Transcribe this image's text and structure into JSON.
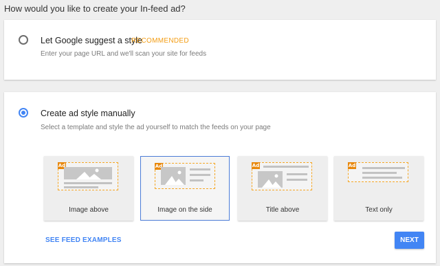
{
  "question": "How would you like to create your In-feed ad?",
  "options": [
    {
      "title": "Let Google suggest a style",
      "badge": "RECOMMENDED",
      "subtitle": "Enter your page URL and we'll scan your site for feeds",
      "selected": false
    },
    {
      "title": "Create ad style manually",
      "subtitle": "Select a template and style the ad yourself to match the feeds on your page",
      "selected": true
    }
  ],
  "templates": [
    {
      "label": "Image above",
      "selected": false
    },
    {
      "label": "Image on the side",
      "selected": true
    },
    {
      "label": "Title above",
      "selected": false
    },
    {
      "label": "Text only",
      "selected": false
    }
  ],
  "ad_tag": "Ad",
  "actions": {
    "examples_link": "SEE FEED EXAMPLES",
    "next_label": "NEXT"
  },
  "colors": {
    "accent": "#4285f4",
    "recommended": "#f39c12",
    "ad_tag": "#e8880c"
  }
}
